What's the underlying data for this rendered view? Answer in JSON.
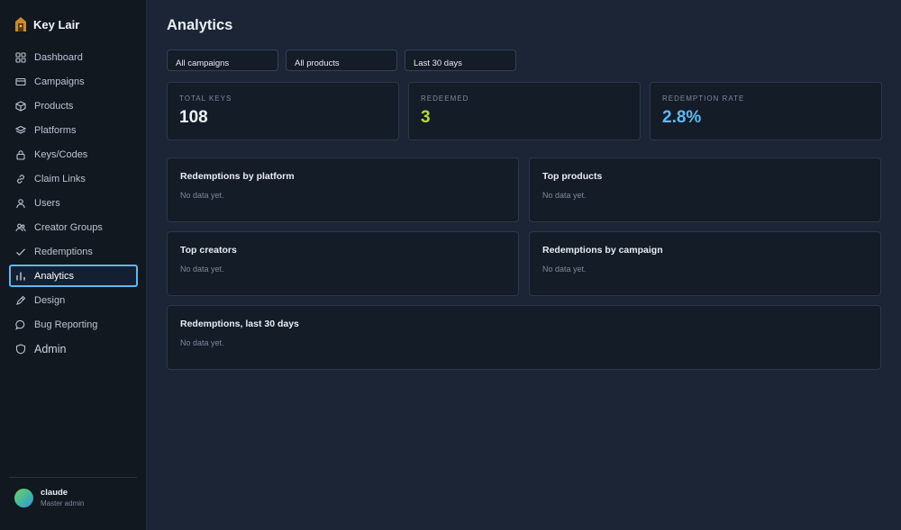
{
  "brand": {
    "name": "Key Lair",
    "icon": "house-key-icon"
  },
  "nav": {
    "items": [
      {
        "label": "Dashboard",
        "icon": "grid-icon"
      },
      {
        "label": "Campaigns",
        "icon": "card-icon"
      },
      {
        "label": "Products",
        "icon": "box-icon"
      },
      {
        "label": "Platforms",
        "icon": "layers-icon"
      },
      {
        "label": "Keys/Codes",
        "icon": "lock-icon"
      },
      {
        "label": "Claim Links",
        "icon": "link-icon"
      },
      {
        "label": "Users",
        "icon": "user-icon"
      },
      {
        "label": "Creator Groups",
        "icon": "users-icon"
      },
      {
        "label": "Redemptions",
        "icon": "check-icon"
      },
      {
        "label": "Analytics",
        "icon": "bar-chart-icon",
        "active": true
      },
      {
        "label": "Design",
        "icon": "pen-icon"
      },
      {
        "label": "Bug Reporting",
        "icon": "chat-icon"
      }
    ],
    "admin": {
      "label": "Admin",
      "icon": "shield-icon"
    }
  },
  "user": {
    "name": "claude",
    "role": "Master admin"
  },
  "page": {
    "title": "Analytics"
  },
  "filters": {
    "campaign": "All campaigns",
    "product": "All products",
    "range": "Last 30 days"
  },
  "stats": {
    "total_keys": {
      "label": "TOTAL KEYS",
      "value": "108"
    },
    "redeemed": {
      "label": "REDEEMED",
      "value": "3"
    },
    "rate": {
      "label": "REDEMPTION RATE",
      "value": "2.8%"
    }
  },
  "panels": {
    "by_platform": {
      "title": "Redemptions by platform",
      "empty": "No data yet."
    },
    "top_products": {
      "title": "Top products",
      "empty": "No data yet."
    },
    "top_creators": {
      "title": "Top creators",
      "empty": "No data yet."
    },
    "by_campaign": {
      "title": "Redemptions by campaign",
      "empty": "No data yet."
    },
    "last_30": {
      "title": "Redemptions, last 30 days",
      "empty": "No data yet."
    }
  },
  "colors": {
    "accent": "#5fb8f0",
    "redeemed": "#b6d92e",
    "background": "#1b2536",
    "sidebar": "#121820"
  }
}
